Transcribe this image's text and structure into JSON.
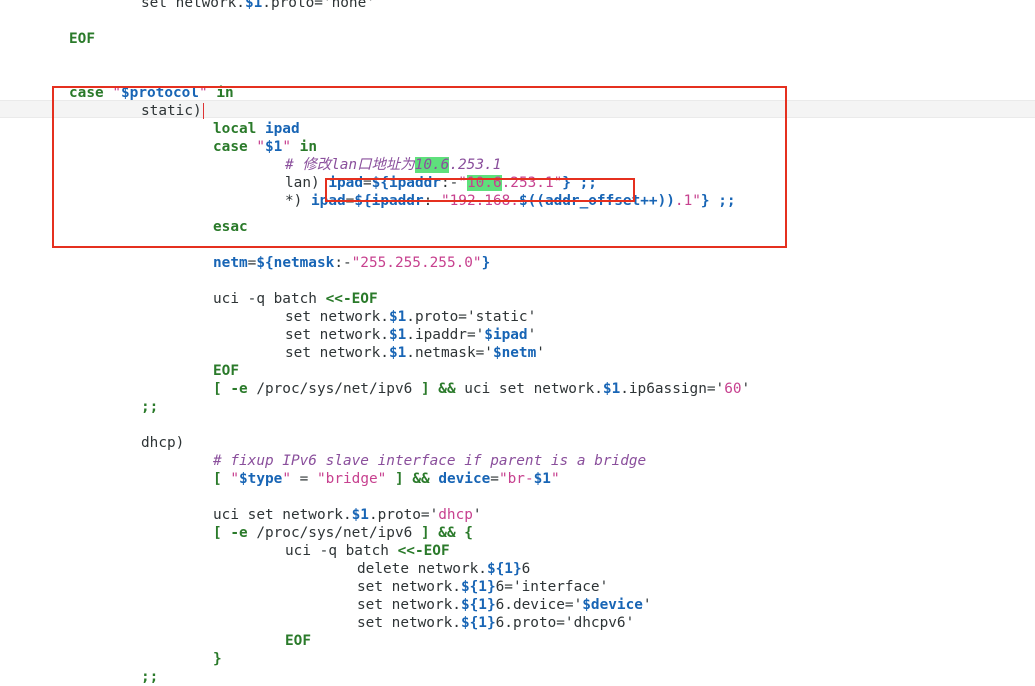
{
  "code_lines": [
    [
      [
        "set network.",
        ""
      ],
      [
        "$1",
        "var"
      ],
      [
        ".proto='none'",
        ""
      ]
    ],
    [
      [
        "EOF",
        "kw"
      ]
    ],
    [
      [
        "case ",
        "kw"
      ],
      [
        "\"",
        "str"
      ],
      [
        "$protocol",
        "var"
      ],
      [
        "\" ",
        "str"
      ],
      [
        "in",
        "kw"
      ]
    ],
    [
      [
        "static)",
        ""
      ]
    ],
    [
      [
        "local ",
        "kw"
      ],
      [
        "ipad",
        "var"
      ]
    ],
    [
      [
        "case ",
        "kw"
      ],
      [
        "\"",
        "str"
      ],
      [
        "$1",
        "var"
      ],
      [
        "\" ",
        "str"
      ],
      [
        "in",
        "kw"
      ]
    ],
    [
      [
        "# 修改lan口地址为",
        "com"
      ],
      [
        "10.6",
        "com hl"
      ],
      [
        ".253.1",
        "com"
      ]
    ],
    [
      [
        "lan) ",
        ""
      ],
      [
        "ipad",
        "var"
      ],
      [
        "=",
        ""
      ],
      [
        "${ipaddr",
        "var"
      ],
      [
        ":-",
        ""
      ],
      [
        "\"",
        "str"
      ],
      [
        "10.6",
        "str hl"
      ],
      [
        ".253.1\"",
        "str"
      ],
      [
        "} ;;",
        "var"
      ]
    ],
    [
      [
        "*) ",
        ""
      ],
      [
        "ipad",
        "var"
      ],
      [
        "=",
        ""
      ],
      [
        "${ipaddr",
        "var"
      ],
      [
        ":-",
        ""
      ],
      [
        "\"192.168.",
        "str"
      ],
      [
        "$((addr_offset++))",
        "var"
      ],
      [
        ".1\"",
        "str"
      ],
      [
        "} ;;",
        "var"
      ]
    ],
    [
      [
        "esac",
        "kw"
      ]
    ],
    [
      [
        "netm",
        "var"
      ],
      [
        "=",
        ""
      ],
      [
        "${netmask",
        "var"
      ],
      [
        ":-",
        ""
      ],
      [
        "\"255.255.255.0\"",
        "str"
      ],
      [
        "}",
        "var"
      ]
    ],
    [
      [
        "uci -q batch ",
        ""
      ],
      [
        "<<-EOF",
        "kw"
      ]
    ],
    [
      [
        "set network.",
        ""
      ],
      [
        "$1",
        "var"
      ],
      [
        ".proto='static'",
        ""
      ]
    ],
    [
      [
        "set network.",
        ""
      ],
      [
        "$1",
        "var"
      ],
      [
        ".ipaddr='",
        ""
      ],
      [
        "$ipad",
        "var"
      ],
      [
        "'",
        ""
      ]
    ],
    [
      [
        "set network.",
        ""
      ],
      [
        "$1",
        "var"
      ],
      [
        ".netmask='",
        ""
      ],
      [
        "$netm",
        "var"
      ],
      [
        "'",
        ""
      ]
    ],
    [
      [
        "EOF",
        "kw"
      ]
    ],
    [
      [
        "[ ",
        "kw"
      ],
      [
        "-e",
        "kw"
      ],
      [
        " /proc/sys/net/ipv6 ",
        ""
      ],
      [
        "]",
        "kw"
      ],
      [
        " ",
        ""
      ],
      [
        "&&",
        "kw"
      ],
      [
        " uci set network.",
        ""
      ],
      [
        "$1",
        "var"
      ],
      [
        ".ip6assign='",
        ""
      ],
      [
        "60",
        "str"
      ],
      [
        "'",
        ""
      ]
    ],
    [
      [
        ";;",
        "kw"
      ]
    ],
    [
      [
        "dhcp)",
        ""
      ]
    ],
    [
      [
        "# fixup IPv6 slave interface if parent is a bridge",
        "com"
      ]
    ],
    [
      [
        "[ ",
        "kw"
      ],
      [
        "\"",
        "str"
      ],
      [
        "$type",
        "var"
      ],
      [
        "\"",
        "str"
      ],
      [
        " = ",
        ""
      ],
      [
        "\"bridge\"",
        "str"
      ],
      [
        " ] ",
        "kw"
      ],
      [
        "&&",
        "kw"
      ],
      [
        " ",
        ""
      ],
      [
        "device",
        "var"
      ],
      [
        "=",
        ""
      ],
      [
        "\"br-",
        "str"
      ],
      [
        "$1",
        "var"
      ],
      [
        "\"",
        "str"
      ]
    ],
    [
      [
        "uci set network.",
        ""
      ],
      [
        "$1",
        "var"
      ],
      [
        ".proto='",
        ""
      ],
      [
        "dhcp",
        "str"
      ],
      [
        "'",
        ""
      ]
    ],
    [
      [
        "[ ",
        "kw"
      ],
      [
        "-e",
        "kw"
      ],
      [
        " /proc/sys/net/ipv6 ",
        ""
      ],
      [
        "]",
        "kw"
      ],
      [
        " ",
        ""
      ],
      [
        "&&",
        "kw"
      ],
      [
        " ",
        ""
      ],
      [
        "{",
        "kw"
      ]
    ],
    [
      [
        "uci -q batch ",
        ""
      ],
      [
        "<<-EOF",
        "kw"
      ]
    ],
    [
      [
        "delete network.",
        ""
      ],
      [
        "${1}",
        "var"
      ],
      [
        "6",
        ""
      ]
    ],
    [
      [
        "set network.",
        ""
      ],
      [
        "${1}",
        "var"
      ],
      [
        "6='interface'",
        ""
      ]
    ],
    [
      [
        "set network.",
        ""
      ],
      [
        "${1}",
        "var"
      ],
      [
        "6.device='",
        ""
      ],
      [
        "$device",
        "var"
      ],
      [
        "'",
        ""
      ]
    ],
    [
      [
        "set network.",
        ""
      ],
      [
        "${1}",
        "var"
      ],
      [
        "6.proto='dhcpv6'",
        ""
      ]
    ],
    [
      [
        "EOF",
        "kw"
      ]
    ],
    [
      [
        "}",
        "kw"
      ]
    ],
    [
      [
        ";;",
        "kw"
      ]
    ]
  ]
}
